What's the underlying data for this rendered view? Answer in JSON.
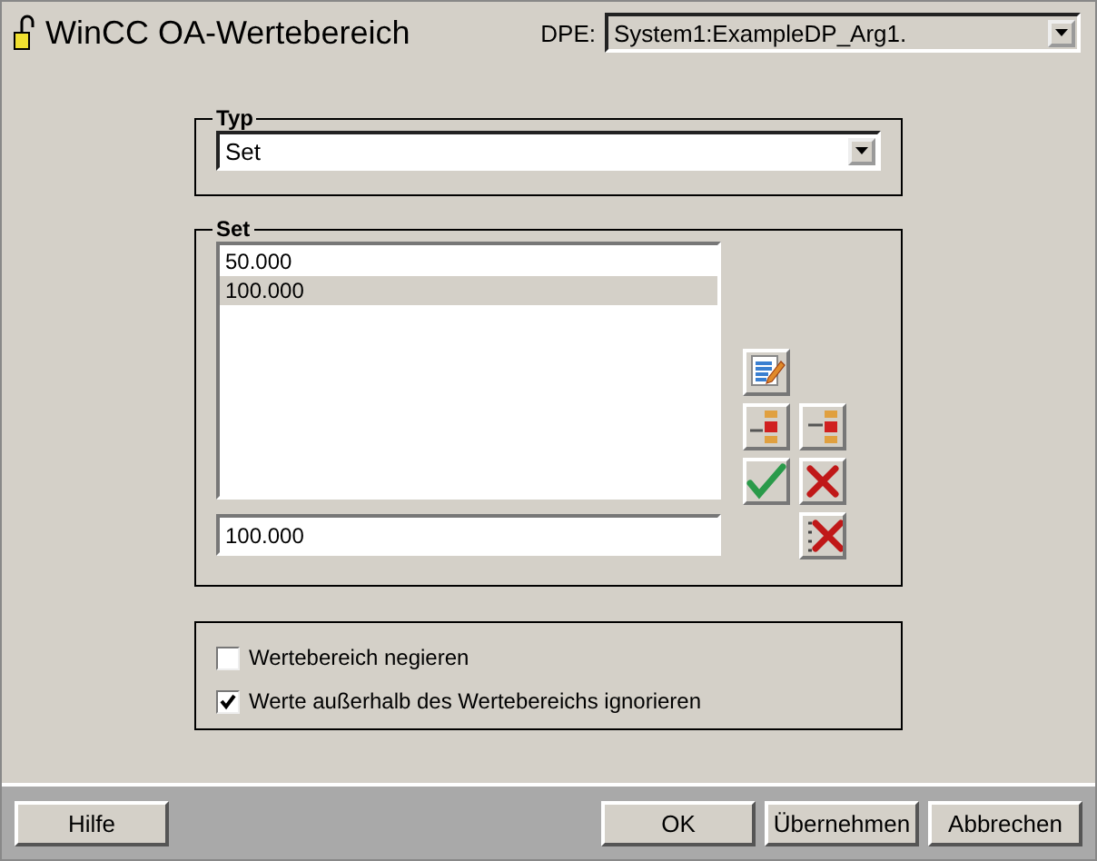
{
  "window": {
    "title": "WinCC OA-Wertebereich"
  },
  "dpe": {
    "label": "DPE:",
    "value": "System1:ExampleDP_Arg1."
  },
  "typ": {
    "legend": "Typ",
    "value": "Set"
  },
  "set": {
    "legend": "Set",
    "items": [
      {
        "text": "50.000",
        "selected": false
      },
      {
        "text": "100.000",
        "selected": true
      }
    ],
    "value": "100.000",
    "tools": [
      {
        "kind": "edit"
      },
      {
        "kind": "insert-before"
      },
      {
        "kind": "insert-after"
      },
      {
        "kind": "accept"
      },
      {
        "kind": "delete"
      },
      {
        "kind": "delete-all"
      }
    ]
  },
  "options": [
    {
      "label": "Wertebereich negieren",
      "checked": false
    },
    {
      "label": "Werte außerhalb des Wertebereichs ignorieren",
      "checked": true
    }
  ],
  "buttons": {
    "left": [
      "Hilfe"
    ],
    "right": [
      "OK",
      "Übernehmen",
      "Abbrechen"
    ]
  }
}
